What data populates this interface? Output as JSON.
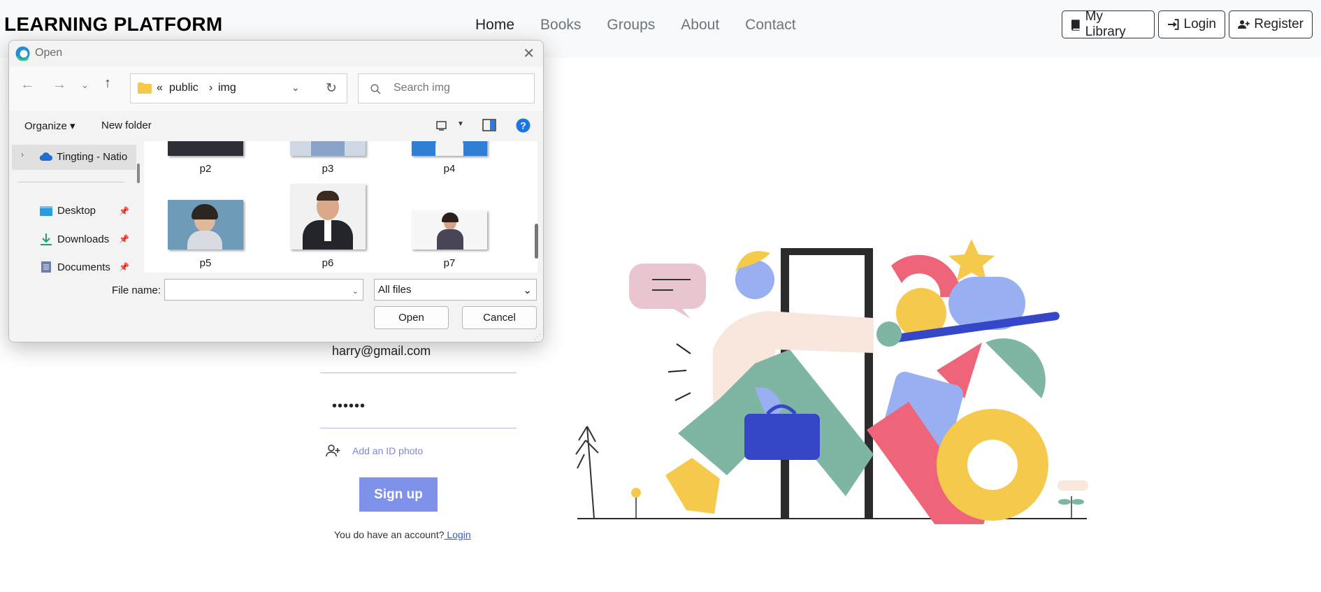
{
  "site": {
    "brand": "LEARNING PLATFORM",
    "nav": [
      "Home",
      "Books",
      "Groups",
      "About",
      "Contact"
    ],
    "active_nav": "Home",
    "buttons": {
      "library": "My Library",
      "login": "Login",
      "register": "Register"
    }
  },
  "form": {
    "email_value": "harry@gmail.com",
    "password_masked": "••••••",
    "add_photo_label": "Add an ID photo",
    "signup_label": "Sign up",
    "account_text": "You do have an account?",
    "login_link": " Login",
    "accent_color": "#7f92ea"
  },
  "dialog": {
    "title": "Open",
    "breadcrumb": {
      "overflow": "«",
      "parent": "public",
      "separator": "›",
      "current": "img"
    },
    "search_placeholder": "Search img",
    "toolbar": {
      "organize": "Organize",
      "new_folder": "New folder"
    },
    "nav_pane": {
      "cloud": "Tingting - Natio",
      "items": [
        {
          "label": "Desktop",
          "icon": "desktop-icon"
        },
        {
          "label": "Downloads",
          "icon": "download-icon"
        },
        {
          "label": "Documents",
          "icon": "document-icon"
        }
      ]
    },
    "files": [
      "p2",
      "p3",
      "p4",
      "p5",
      "p6",
      "p7"
    ],
    "file_name_label": "File name:",
    "file_name_value": "",
    "file_type_filter": "All files",
    "open_button": "Open",
    "cancel_button": "Cancel"
  }
}
